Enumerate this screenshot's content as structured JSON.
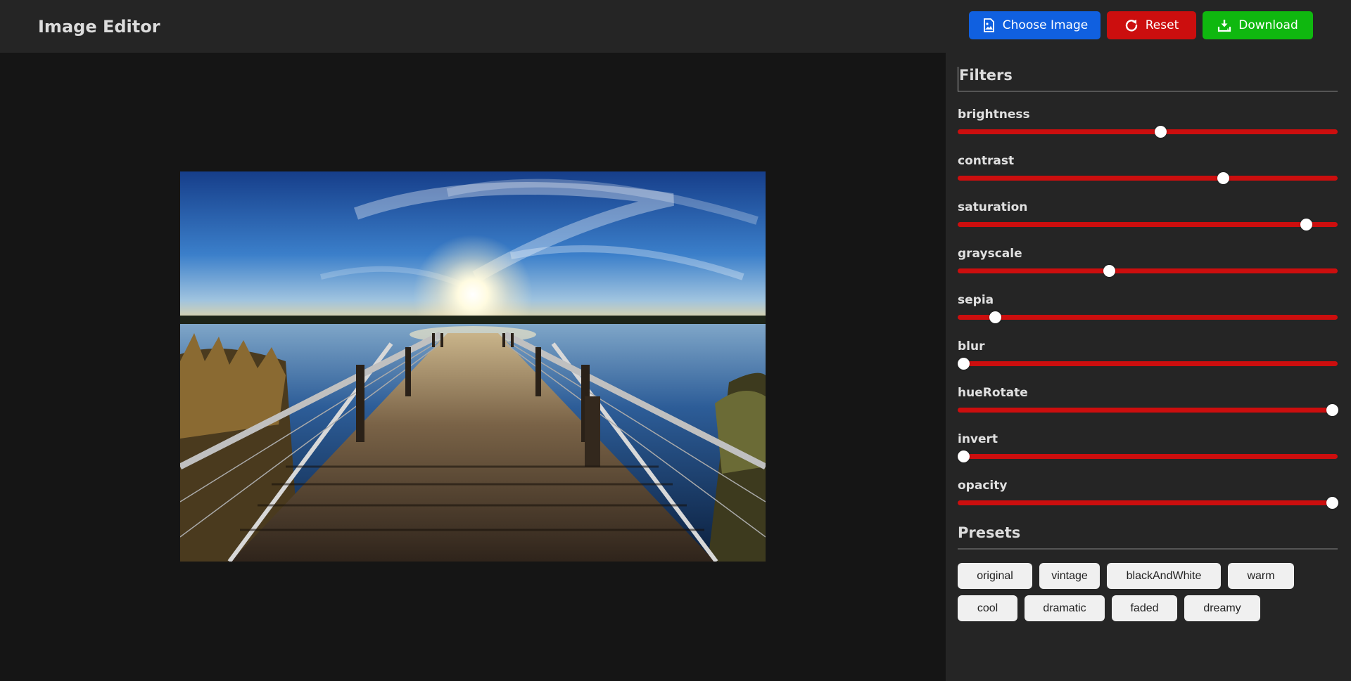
{
  "header": {
    "title": "Image Editor",
    "choose_label": "Choose Image",
    "reset_label": "Reset",
    "download_label": "Download"
  },
  "filters": {
    "heading": "Filters",
    "items": [
      {
        "label": "brightness",
        "level": 0.535
      },
      {
        "label": "contrast",
        "level": 0.705
      },
      {
        "label": "saturation",
        "level": 0.93
      },
      {
        "label": "grayscale",
        "level": 0.395
      },
      {
        "label": "sepia",
        "level": 0.085
      },
      {
        "label": "blur",
        "level": 0.0
      },
      {
        "label": "hueRotate",
        "level": 1.0
      },
      {
        "label": "invert",
        "level": 0.0
      },
      {
        "label": "opacity",
        "level": 1.0
      }
    ]
  },
  "presets": {
    "heading": "Presets",
    "items": [
      "original",
      "vintage",
      "blackAndWhite",
      "warm",
      "cool",
      "dramatic",
      "faded",
      "dreamy"
    ]
  },
  "colors": {
    "choose_button": "#1060e0",
    "reset_button": "#cc0e0e",
    "download_button": "#0fb80f",
    "slider_track": "#cc0e0e"
  }
}
